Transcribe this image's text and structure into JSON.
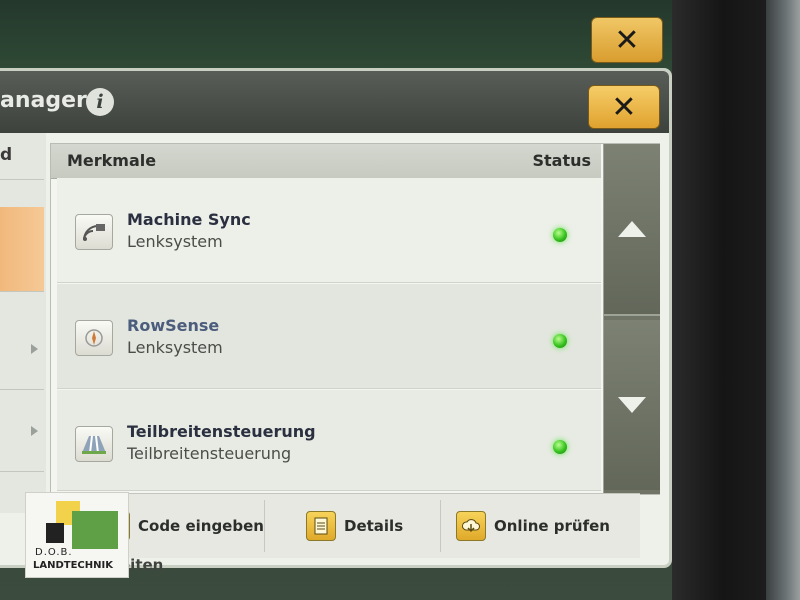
{
  "back_window": {
    "close_label": "✕"
  },
  "dialog": {
    "title": "anager",
    "info_icon_glyph": "i",
    "close_label": "✕",
    "left_panel": {
      "row0_text": "d"
    },
    "table": {
      "header_features": "Merkmale",
      "header_status": "Status",
      "rows": [
        {
          "name": "Machine Sync",
          "subtitle": "Lenksystem",
          "icon": "machine-sync-icon",
          "status_color": "#37c21f"
        },
        {
          "name": "RowSense",
          "subtitle": "Lenksystem",
          "icon": "rowsense-icon",
          "status_color": "#37c21f"
        },
        {
          "name": "Teilbreitensteuerung",
          "subtitle": "Teilbreitensteuerung",
          "icon": "section-control-icon",
          "status_color": "#37c21f"
        }
      ]
    },
    "footer": {
      "enter_code_label": "Code eingeben",
      "details_label": "Details",
      "online_check_label": "Online prüfen"
    },
    "below_label": "eiten"
  },
  "watermark": {
    "line1": "D.O.B.",
    "line2": "LANDTECHNIK"
  }
}
